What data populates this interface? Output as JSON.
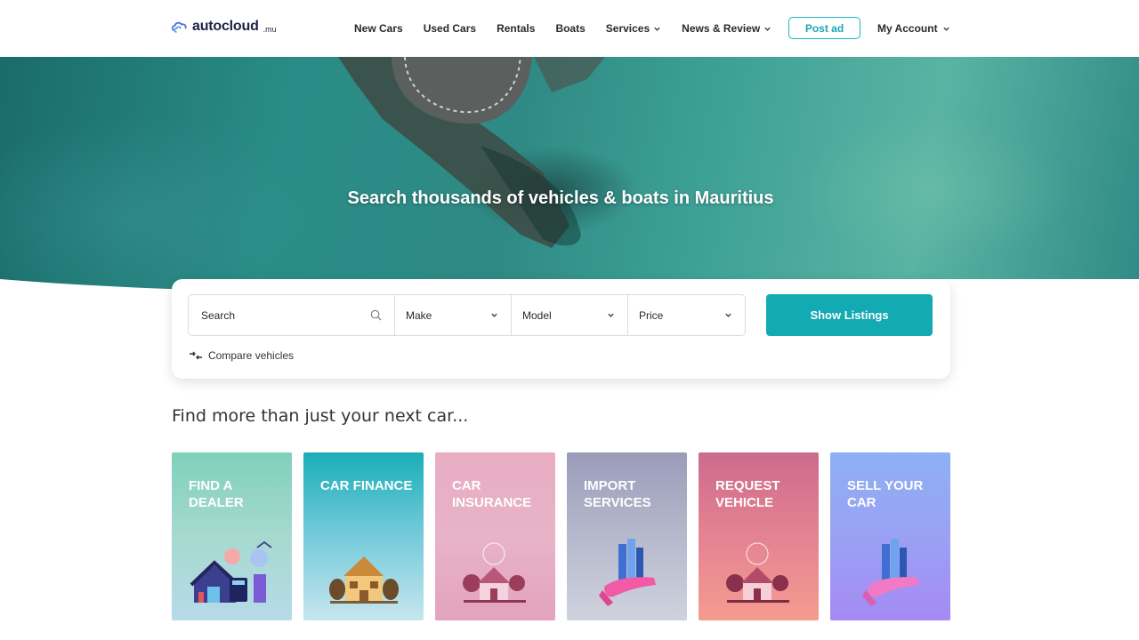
{
  "header": {
    "logo": {
      "text": "autocloud",
      "suffix": ".mu"
    },
    "nav": [
      {
        "label": "New Cars",
        "dropdown": false
      },
      {
        "label": "Used Cars",
        "dropdown": false
      },
      {
        "label": "Rentals",
        "dropdown": false
      },
      {
        "label": "Boats",
        "dropdown": false
      },
      {
        "label": "Services",
        "dropdown": true
      },
      {
        "label": "News & Review",
        "dropdown": true
      }
    ],
    "post_ad": "Post ad",
    "account": "My Account"
  },
  "hero": {
    "title": "Search thousands of vehicles & boats in Mauritius"
  },
  "search": {
    "search_placeholder": "Search",
    "make": "Make",
    "model": "Model",
    "price": "Price",
    "show_listings": "Show Listings",
    "compare": "Compare vehicles"
  },
  "section": {
    "title": "Find more than just your next car..."
  },
  "cards": [
    {
      "label": "Find a Dealer",
      "icon": "dealer-illustration-icon",
      "colors": [
        "#7fd0bb",
        "#b6dbe8"
      ]
    },
    {
      "label": "Car Finance",
      "icon": "house-illustration-icon",
      "colors": [
        "#19aeb7",
        "#c7e6ee"
      ]
    },
    {
      "label": "Car Insurance",
      "icon": "insured-house-illustration-icon",
      "colors": [
        "#e8adc3",
        "#e3a3bd"
      ]
    },
    {
      "label": "Import Services",
      "icon": "hand-building-illustration-icon",
      "colors": [
        "#9b9bb9",
        "#cfd2de"
      ]
    },
    {
      "label": "Request Vehicle",
      "icon": "house-illustration-icon",
      "colors": [
        "#cd6b8c",
        "#f49c8f"
      ]
    },
    {
      "label": "Sell your car",
      "icon": "hand-building-illustration-icon",
      "colors": [
        "#8eb0f4",
        "#a58af3"
      ]
    }
  ],
  "colors": {
    "accent": "#13aab3",
    "brand_text": "#1f2245"
  }
}
